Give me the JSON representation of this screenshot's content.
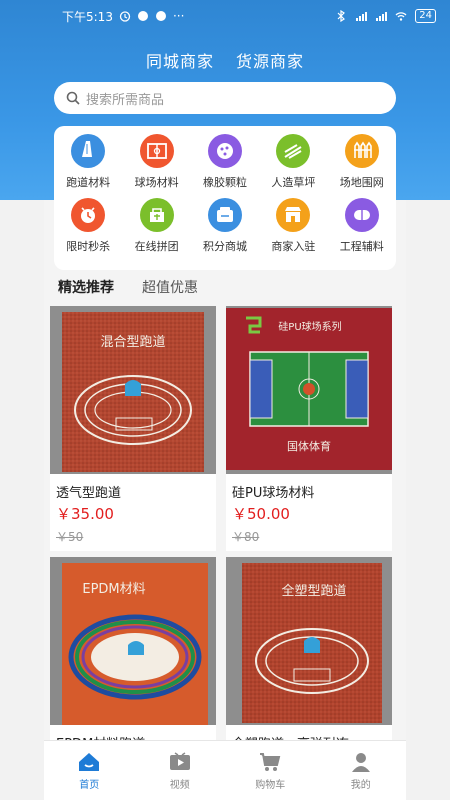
{
  "status_bar": {
    "time": "下午5:13",
    "battery": "24"
  },
  "top_tabs": [
    "同城商家",
    "货源商家"
  ],
  "search": {
    "placeholder": "搜索所需商品"
  },
  "categories": [
    {
      "label": "跑道材料",
      "icon": "track-icon",
      "color": "#3b8fe0"
    },
    {
      "label": "球场材料",
      "icon": "court-icon",
      "color": "#f0562f"
    },
    {
      "label": "橡胶颗粒",
      "icon": "granule-icon",
      "color": "#8a5be2"
    },
    {
      "label": "人造草坪",
      "icon": "turf-icon",
      "color": "#7bbf2b"
    },
    {
      "label": "场地围网",
      "icon": "fence-icon",
      "color": "#f4a11a"
    },
    {
      "label": "限时秒杀",
      "icon": "clock-icon",
      "color": "#f0562f"
    },
    {
      "label": "在线拼团",
      "icon": "group-icon",
      "color": "#7bbf2b"
    },
    {
      "label": "积分商城",
      "icon": "points-icon",
      "color": "#3b8fe0"
    },
    {
      "label": "商家入驻",
      "icon": "shop-icon",
      "color": "#f4a11a"
    },
    {
      "label": "工程辅料",
      "icon": "supplies-icon",
      "color": "#8a5be2"
    }
  ],
  "section_tabs": {
    "active": "精选推荐",
    "other": "超值优惠"
  },
  "products": [
    {
      "name": "透气型跑道",
      "price": "￥35.00",
      "old_price": "￥50",
      "image_text": "混合型跑道"
    },
    {
      "name": "硅PU球场材料",
      "price": "￥50.00",
      "old_price": "￥80",
      "image_text": "硅PU球场系列",
      "image_sub": "国体体育"
    },
    {
      "name": "EPDM材料跑道",
      "price": "",
      "old_price": "",
      "image_text": "EPDM材料"
    },
    {
      "name": "全塑跑道、高弹耐冻",
      "price": "",
      "old_price": "",
      "image_text": "全塑型跑道"
    }
  ],
  "tabbar": [
    {
      "label": "首页",
      "icon": "home-icon",
      "active": true
    },
    {
      "label": "视频",
      "icon": "video-icon",
      "active": false
    },
    {
      "label": "购物车",
      "icon": "cart-icon",
      "active": false
    },
    {
      "label": "我的",
      "icon": "user-icon",
      "active": false
    }
  ],
  "colors": {
    "primary": "#2f86d3",
    "price": "#e21e1e",
    "tab_active": "#1e7bd6"
  }
}
